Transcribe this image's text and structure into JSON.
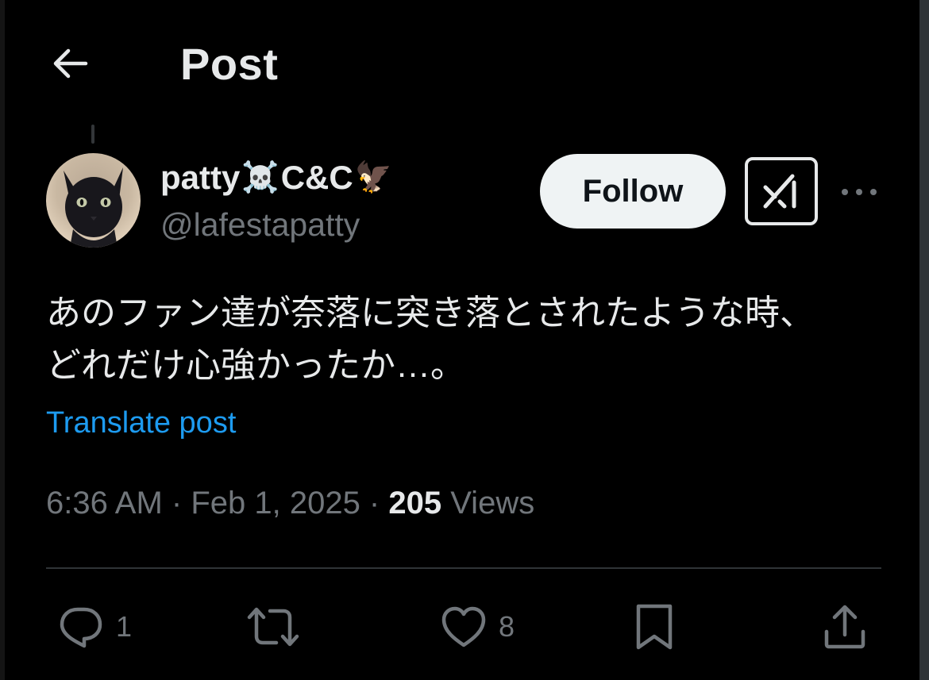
{
  "header": {
    "title": "Post"
  },
  "author": {
    "name": "patty",
    "name_emoji_1": "☠️",
    "name_mid": "C&C",
    "name_emoji_2": "🦅",
    "handle": "@lafestapatty"
  },
  "follow_label": "Follow",
  "post": {
    "line1": "あのファン達が奈落に突き落とされたような時、",
    "line2": "どれだけ心強かったか…。",
    "translate_label": "Translate post"
  },
  "meta": {
    "time": "6:36 AM",
    "sep1": " · ",
    "date": "Feb 1, 2025",
    "sep2": " · ",
    "views_count": "205",
    "views_label": " Views"
  },
  "actions": {
    "replies": "1",
    "reposts": "",
    "likes": "8"
  },
  "icons": {
    "back": "arrow-left-icon",
    "grok": "grok-icon",
    "more": "more-horizontal-icon",
    "reply": "reply-icon",
    "repost": "repost-icon",
    "like": "heart-icon",
    "bookmark": "bookmark-icon",
    "share": "share-icon"
  },
  "colors": {
    "background": "#000000",
    "text": "#e7e9ea",
    "muted": "#71767b",
    "link": "#1d9bf0",
    "follow_bg": "#eff3f4"
  }
}
